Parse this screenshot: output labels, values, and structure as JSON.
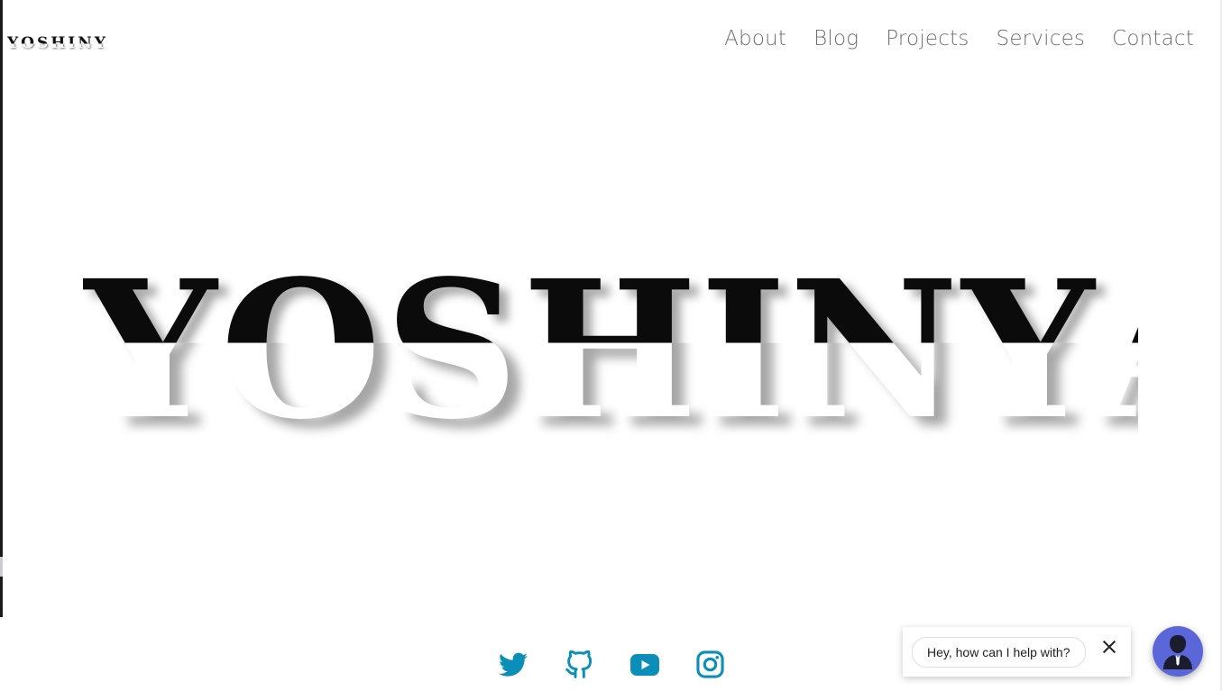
{
  "brand": {
    "logo_text": "YOSHINYA"
  },
  "nav": {
    "items": [
      {
        "label": "About"
      },
      {
        "label": "Blog"
      },
      {
        "label": "Projects"
      },
      {
        "label": "Services"
      },
      {
        "label": "Contact"
      }
    ]
  },
  "hero": {
    "letters": [
      "Y",
      "O",
      "S",
      "H",
      "I",
      "N",
      "Y",
      "A"
    ]
  },
  "social": {
    "icons": [
      "twitter-icon",
      "github-icon",
      "youtube-icon",
      "instagram-icon"
    ],
    "color": "#0b8fb8"
  },
  "chat": {
    "prompt": "Hey, how can I help with?",
    "launcher_color": "#5b67d8"
  },
  "colors": {
    "nav_text": "#707070",
    "hero_dark": "#0b0b0b",
    "background": "#ffffff"
  }
}
